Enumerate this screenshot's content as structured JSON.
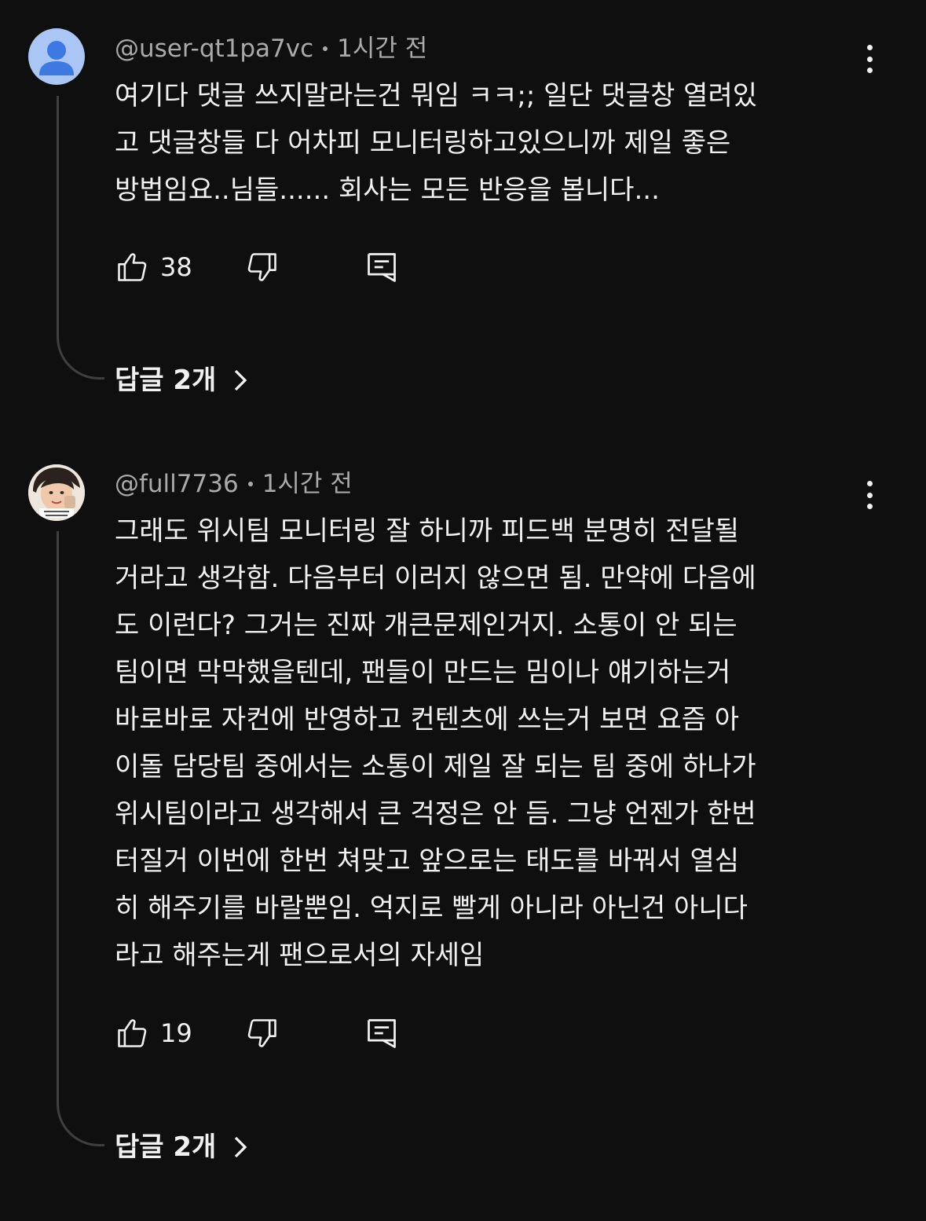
{
  "comments": [
    {
      "author": "@user-qt1pa7vc",
      "time": "1시간 전",
      "avatar_icon": "default-person-avatar",
      "text_lines": [
        "여기다 댓글 쓰지말라는건 뭐임 ㅋㅋ;; 일단 댓글창 열려있",
        "고 댓글창들 다 어차피 모니터링하고있으니까 제일 좋은",
        "방법임요..님들...... 회사는 모든 반응을 봅니다..."
      ],
      "likes": "38",
      "replies_label": "답글 2개"
    },
    {
      "author": "@full7736",
      "time": "1시간 전",
      "avatar_icon": "photo-avatar",
      "text_lines": [
        "그래도 위시팀 모니터링 잘 하니까 피드백 분명히 전달될",
        "거라고 생각함. 다음부터 이러지 않으면 됨. 만약에 다음에",
        "도 이런다? 그거는 진짜 개큰문제인거지. 소통이 안 되는",
        "팀이면 막막했을텐데, 팬들이 만드는 밈이나 얘기하는거",
        "바로바로 자컨에 반영하고 컨텐츠에 쓰는거 보면 요즘 아",
        "이돌 담당팀 중에서는 소통이 제일 잘 되는 팀 중에 하나가",
        "위시팀이라고 생각해서 큰 걱정은 안 듬. 그냥 언젠가 한번",
        "터질거 이번에 한번 쳐맞고 앞으로는 태도를 바꿔서 열심",
        "히 해주기를 바랄뿐임. 억지로 빨게 아니라 아닌건 아니다",
        "라고 해주는게 팬으로서의 자세임"
      ],
      "likes": "19",
      "replies_label": "답글 2개"
    }
  ],
  "colors": {
    "background": "#0f0f0f",
    "text": "#f1f1f1",
    "meta": "#aaaaaa",
    "default_avatar": "#a9c6f5",
    "default_avatar_figure": "#3d79e0"
  }
}
